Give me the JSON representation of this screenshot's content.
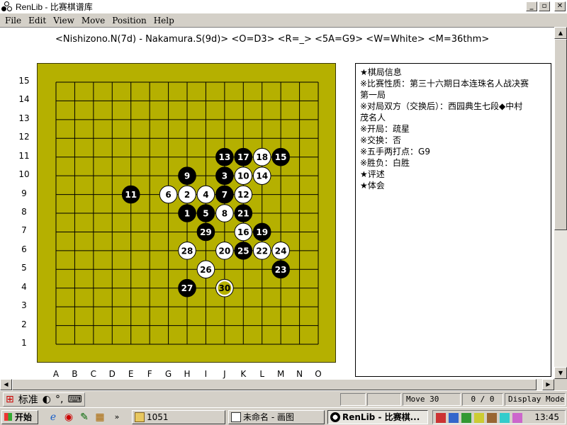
{
  "window": {
    "title": "RenLib - 比赛棋谱库",
    "minimize": "_",
    "maximize": "▫",
    "close": "✕"
  },
  "menu": [
    {
      "label": "File"
    },
    {
      "label": "Edit"
    },
    {
      "label": "View"
    },
    {
      "label": "Move"
    },
    {
      "label": "Position"
    },
    {
      "label": "Help"
    }
  ],
  "game_header": "<Nishizono.N(7d) - Nakamura.S(9d)>  <O=D3>  <R=_>  <5A=G9>  <W=White>  <M=36thm>",
  "board": {
    "size": 15,
    "columns": [
      "A",
      "B",
      "C",
      "D",
      "E",
      "F",
      "G",
      "H",
      "I",
      "J",
      "K",
      "L",
      "M",
      "N",
      "O"
    ],
    "rows": [
      "15",
      "14",
      "13",
      "12",
      "11",
      "10",
      "9",
      "8",
      "7",
      "6",
      "5",
      "4",
      "3",
      "2",
      "1"
    ],
    "board_color": "#b5b000",
    "last_move_fill": "#b5b000",
    "moves": [
      {
        "n": 1,
        "color": "black",
        "pos": "H8"
      },
      {
        "n": 2,
        "color": "white",
        "pos": "H9"
      },
      {
        "n": 3,
        "color": "black",
        "pos": "J10"
      },
      {
        "n": 4,
        "color": "white",
        "pos": "I9"
      },
      {
        "n": 5,
        "color": "black",
        "pos": "I8"
      },
      {
        "n": 6,
        "color": "white",
        "pos": "G9"
      },
      {
        "n": 7,
        "color": "black",
        "pos": "J9"
      },
      {
        "n": 8,
        "color": "white",
        "pos": "J8"
      },
      {
        "n": 9,
        "color": "black",
        "pos": "H10"
      },
      {
        "n": 10,
        "color": "white",
        "pos": "K10"
      },
      {
        "n": 11,
        "color": "black",
        "pos": "E9"
      },
      {
        "n": 12,
        "color": "white",
        "pos": "K9"
      },
      {
        "n": 13,
        "color": "black",
        "pos": "J11"
      },
      {
        "n": 14,
        "color": "white",
        "pos": "L10"
      },
      {
        "n": 15,
        "color": "black",
        "pos": "M11"
      },
      {
        "n": 16,
        "color": "white",
        "pos": "K7"
      },
      {
        "n": 17,
        "color": "black",
        "pos": "K11"
      },
      {
        "n": 18,
        "color": "white",
        "pos": "L11"
      },
      {
        "n": 19,
        "color": "black",
        "pos": "L7"
      },
      {
        "n": 20,
        "color": "white",
        "pos": "J6"
      },
      {
        "n": 21,
        "color": "black",
        "pos": "K8"
      },
      {
        "n": 22,
        "color": "white",
        "pos": "L6"
      },
      {
        "n": 23,
        "color": "black",
        "pos": "M5"
      },
      {
        "n": 24,
        "color": "white",
        "pos": "M6"
      },
      {
        "n": 25,
        "color": "black",
        "pos": "K6"
      },
      {
        "n": 26,
        "color": "white",
        "pos": "I5"
      },
      {
        "n": 27,
        "color": "black",
        "pos": "H4"
      },
      {
        "n": 28,
        "color": "white",
        "pos": "H6"
      },
      {
        "n": 29,
        "color": "black",
        "pos": "I7"
      },
      {
        "n": 30,
        "color": "white",
        "pos": "J4",
        "last": true
      }
    ]
  },
  "info_panel": [
    "★棋局信息",
    "※比赛性质：第三十六期日本连珠名人战决赛",
    "第一局",
    "※对局双方（交换后）：西园典生七段◆中村",
    "茂名人",
    "※开局：疏星",
    "※交换：否",
    "※五手两打点：G9",
    "※胜负：白胜",
    "★评述",
    "★体会"
  ],
  "statusbar": {
    "ime_mode": "标准",
    "move": "Move 30",
    "count": "0 / 0",
    "mode": "Display Mode"
  },
  "taskbar": {
    "start": "开始",
    "tasks": [
      {
        "label": "1051"
      },
      {
        "label": "未命名 - 画图"
      },
      {
        "label": "RenLib - 比赛棋..."
      }
    ],
    "clock": "13:45"
  }
}
